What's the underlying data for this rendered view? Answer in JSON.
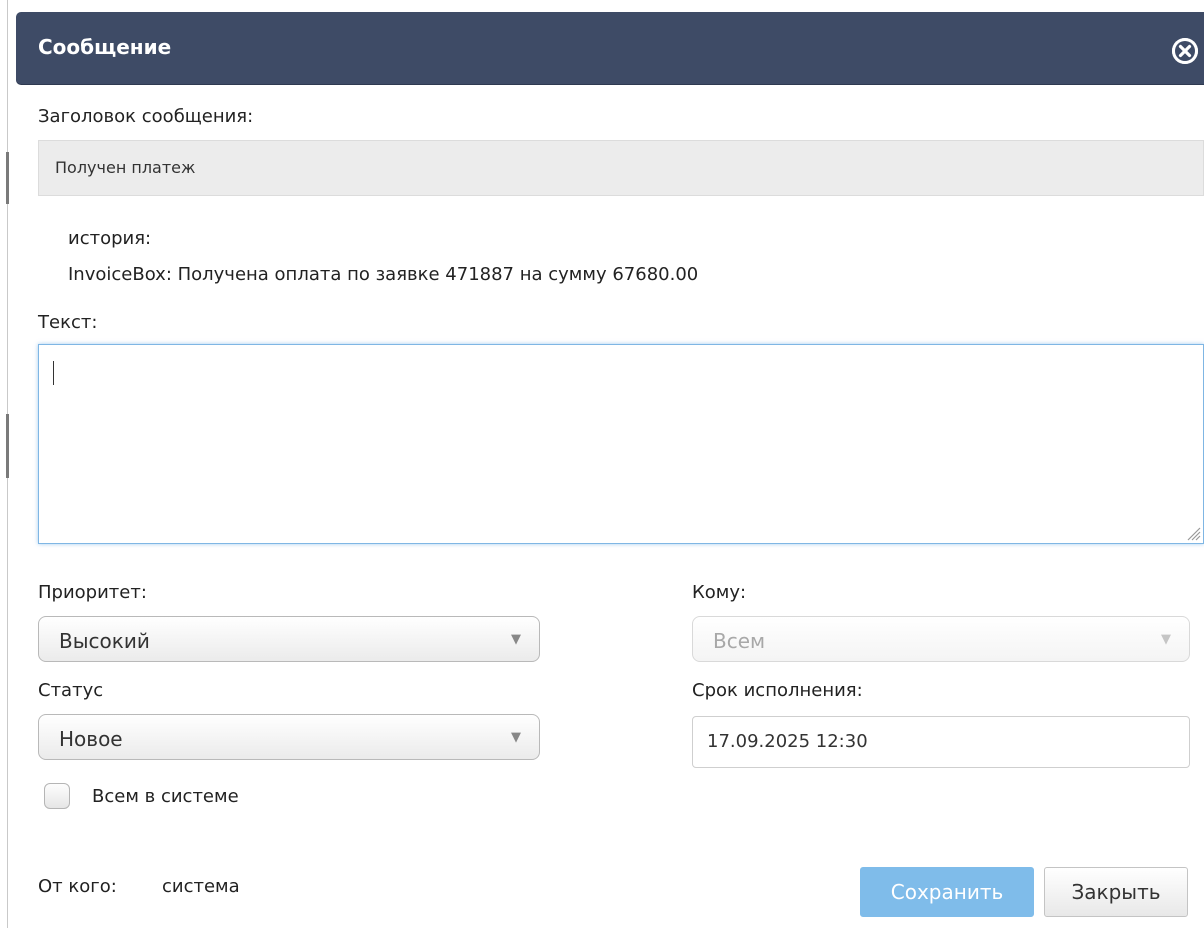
{
  "dialog": {
    "title": "Сообщение",
    "close_icon": "close-circle-icon"
  },
  "form": {
    "subject_label": "Заголовок сообщения:",
    "subject_value": "Получен платеж",
    "history_label": "история:",
    "history_text": "InvoiceBox: Получена оплата по заявке 471887 на сумму 67680.00",
    "text_label": "Текст:",
    "text_value": "",
    "priority_label": "Приоритет:",
    "priority_value": "Высокий",
    "to_label": "Кому:",
    "to_value": "Всем",
    "status_label": "Статус",
    "status_value": "Новое",
    "deadline_label": "Срок исполнения:",
    "deadline_value": "17.09.2025 12:30",
    "all_in_system_label": "Всем в системе",
    "all_in_system_checked": false,
    "from_label": "От кого:",
    "from_value": "система"
  },
  "buttons": {
    "save": "Сохранить",
    "close": "Закрыть"
  },
  "colors": {
    "titlebar": "#3e4b66",
    "save_button": "#7fbcea",
    "focus_border": "#7fb6e4"
  }
}
